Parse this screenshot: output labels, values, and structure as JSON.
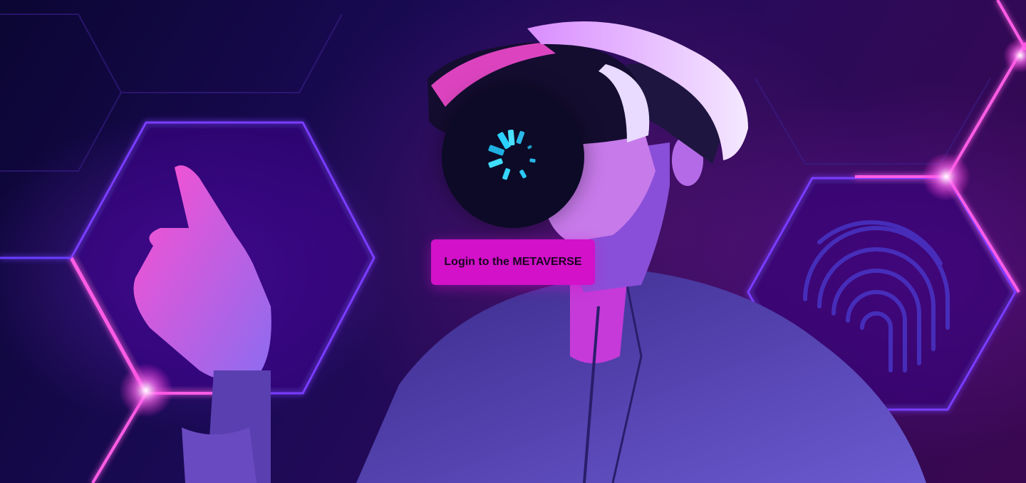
{
  "hero": {
    "background_image": "vr-headset-metaverse-person",
    "colors": {
      "background_dark": "#0b0633",
      "neon_pink": "#ff2bd6",
      "neon_purple": "#7a3cff",
      "spinner_cyan": "#2ad1ff"
    }
  },
  "loader": {
    "icon": "loading-spinner-icon"
  },
  "login": {
    "button_label": "Login to the METAVERSE",
    "button_color": "#d211c9"
  }
}
